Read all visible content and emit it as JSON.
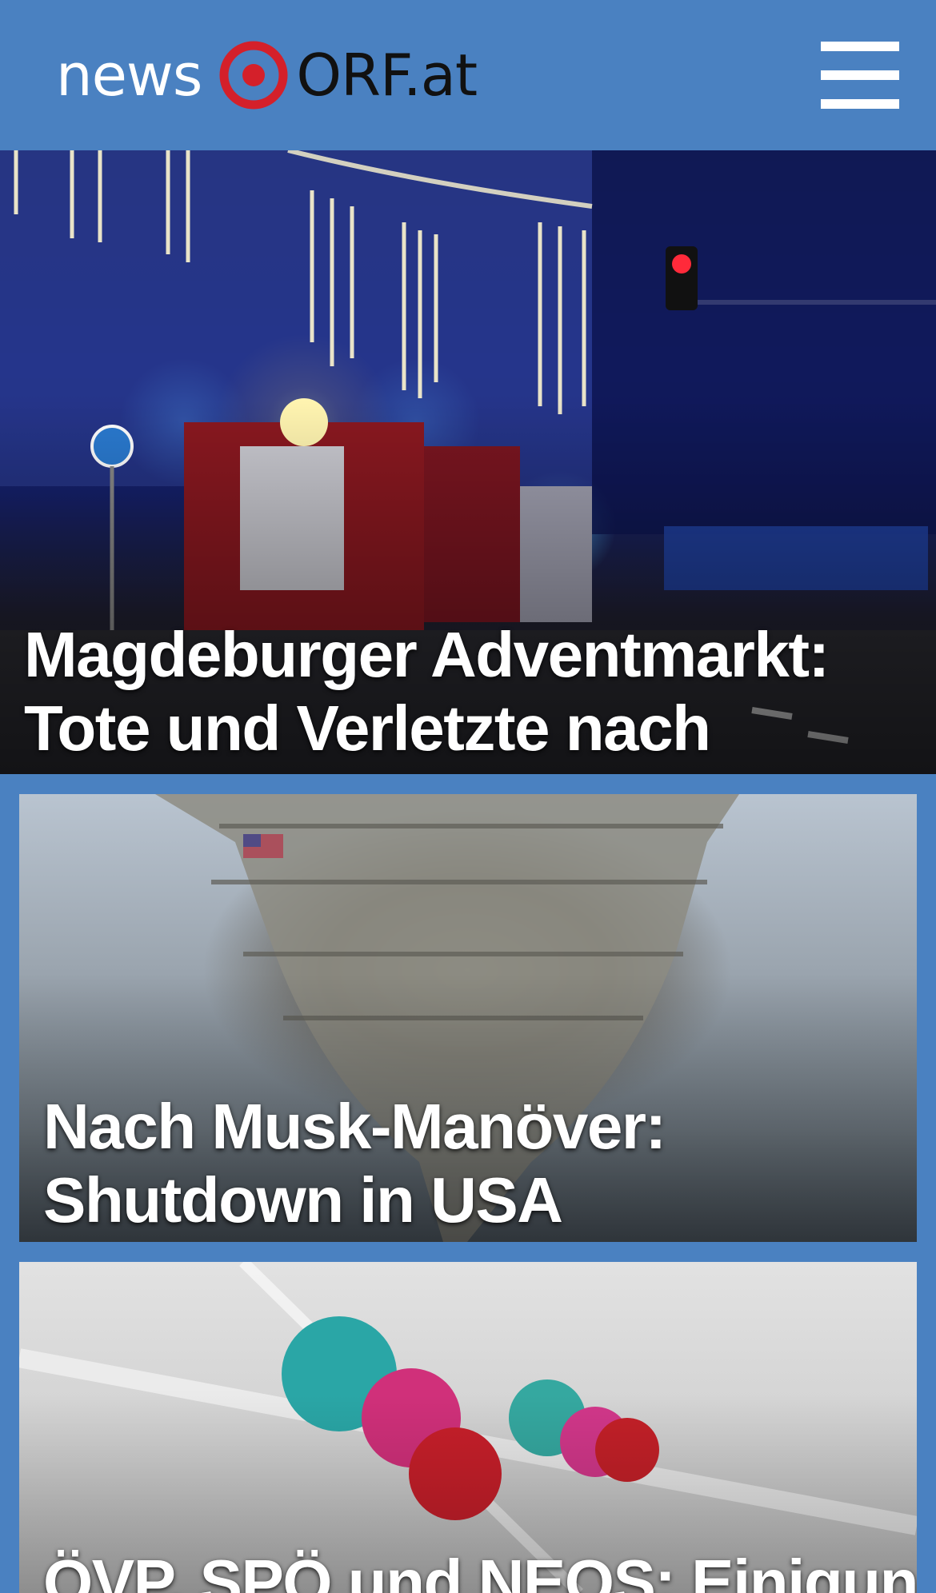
{
  "header": {
    "logo_news": "news",
    "logo_orf": "ORF.at",
    "menu_icon": "hamburger-menu-icon",
    "background_color": "#4a81c1"
  },
  "stories": [
    {
      "title": "Magdeburger Adventmarkt: Tote und Verletzte nach Anschlag",
      "image": "fire-trucks-night-christmas-market-photo"
    },
    {
      "title": "Nach Musk-Manöver: Shutdown in USA abgewendet",
      "image": "us-capitol-dome-reflection-photo"
    },
    {
      "title": "ÖVP, SPÖ und NEOS: Einigung über",
      "image": "colored-molecule-balls-photo"
    }
  ],
  "colors": {
    "brand_blue": "#4a81c1",
    "orf_red": "#d4202a"
  }
}
